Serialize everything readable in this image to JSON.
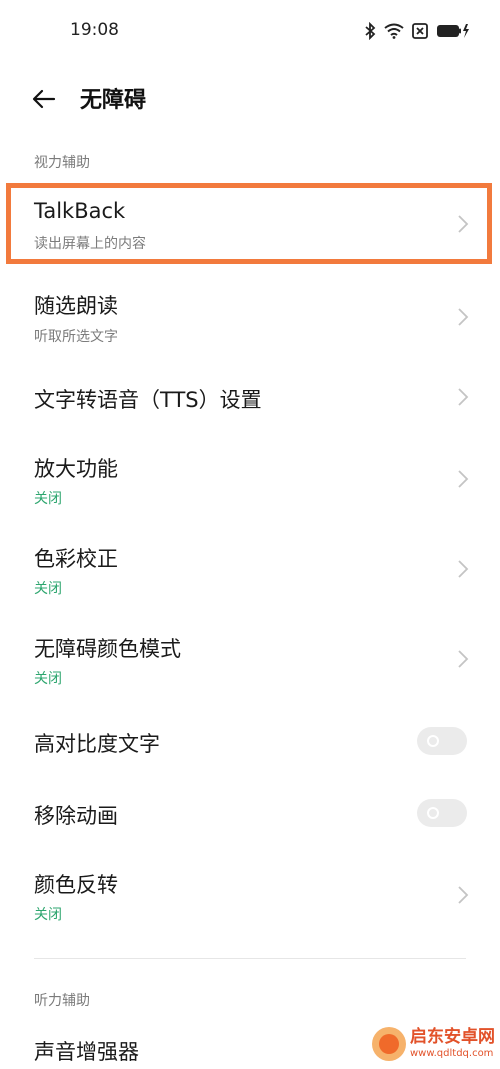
{
  "status_bar": {
    "time": "19:08",
    "icons": [
      "bluetooth-icon",
      "wifi-icon",
      "sim-x-icon",
      "battery-charging-icon"
    ]
  },
  "header": {
    "back_icon": "arrow-left-icon",
    "title": "无障碍"
  },
  "sections": {
    "vision": "视力辅助",
    "hearing": "听力辅助"
  },
  "rows": {
    "talkback": {
      "title": "TalkBack",
      "subtitle": "读出屏幕上的内容"
    },
    "select_to_speak": {
      "title": "随选朗读",
      "subtitle": "听取所选文字"
    },
    "tts": {
      "title": "文字转语音（TTS）设置"
    },
    "magnification": {
      "title": "放大功能",
      "subtitle": "关闭"
    },
    "color_correction": {
      "title": "色彩校正",
      "subtitle": "关闭"
    },
    "color_mode": {
      "title": "无障碍颜色模式",
      "subtitle": "关闭"
    },
    "high_contrast": {
      "title": "高对比度文字",
      "toggle_on": false
    },
    "remove_animation": {
      "title": "移除动画",
      "toggle_on": false
    },
    "color_inversion": {
      "title": "颜色反转",
      "subtitle": "关闭"
    },
    "sound_amplifier": {
      "title": "声音增强器"
    }
  },
  "colors": {
    "highlight": "#f27a3d",
    "status_off": "#2ea66f",
    "subtitle_gray": "#7c7c7c"
  },
  "watermark": {
    "name": "启东安卓网",
    "url": "www.qdltdq.com"
  }
}
